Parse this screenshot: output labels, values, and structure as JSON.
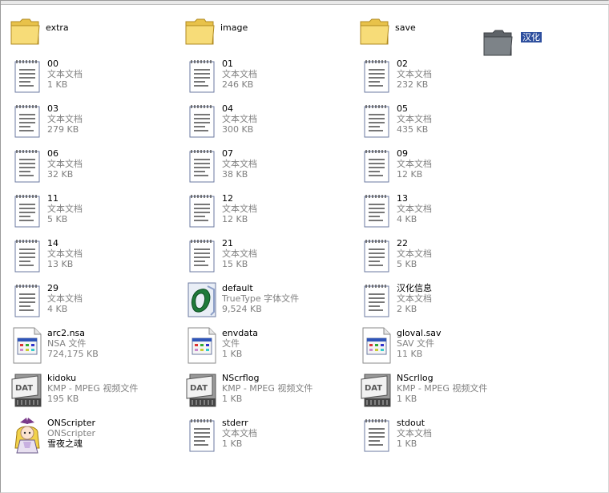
{
  "folders": [
    {
      "name": "extra",
      "icon": "folder-icon"
    },
    {
      "name": "image",
      "icon": "folder-icon"
    },
    {
      "name": "save",
      "icon": "folder-icon"
    }
  ],
  "selected_folder": {
    "name": "汉化",
    "icon": "folder-dark-icon"
  },
  "files": [
    {
      "name": "00",
      "type": "文本文档",
      "size": "1 KB",
      "icon": "text-document-icon"
    },
    {
      "name": "01",
      "type": "文本文档",
      "size": "246 KB",
      "icon": "text-document-icon"
    },
    {
      "name": "02",
      "type": "文本文档",
      "size": "232 KB",
      "icon": "text-document-icon"
    },
    {
      "name": "03",
      "type": "文本文档",
      "size": "279 KB",
      "icon": "text-document-icon"
    },
    {
      "name": "04",
      "type": "文本文档",
      "size": "300 KB",
      "icon": "text-document-icon"
    },
    {
      "name": "05",
      "type": "文本文档",
      "size": "435 KB",
      "icon": "text-document-icon"
    },
    {
      "name": "06",
      "type": "文本文档",
      "size": "32 KB",
      "icon": "text-document-icon"
    },
    {
      "name": "07",
      "type": "文本文档",
      "size": "38 KB",
      "icon": "text-document-icon"
    },
    {
      "name": "09",
      "type": "文本文档",
      "size": "12 KB",
      "icon": "text-document-icon"
    },
    {
      "name": "11",
      "type": "文本文档",
      "size": "5 KB",
      "icon": "text-document-icon"
    },
    {
      "name": "12",
      "type": "文本文档",
      "size": "12 KB",
      "icon": "text-document-icon"
    },
    {
      "name": "13",
      "type": "文本文档",
      "size": "4 KB",
      "icon": "text-document-icon"
    },
    {
      "name": "14",
      "type": "文本文档",
      "size": "13 KB",
      "icon": "text-document-icon"
    },
    {
      "name": "21",
      "type": "文本文档",
      "size": "15 KB",
      "icon": "text-document-icon"
    },
    {
      "name": "22",
      "type": "文本文档",
      "size": "5 KB",
      "icon": "text-document-icon"
    },
    {
      "name": "29",
      "type": "文本文档",
      "size": "4 KB",
      "icon": "text-document-icon"
    },
    {
      "name": "default",
      "type": "TrueType 字体文件",
      "size": "9,524 KB",
      "icon": "truetype-font-icon"
    },
    {
      "name": "汉化信息",
      "type": "文本文档",
      "size": "2 KB",
      "icon": "text-document-icon"
    },
    {
      "name": "arc2.nsa",
      "type": "NSA 文件",
      "size": "724,175 KB",
      "icon": "generic-file-icon"
    },
    {
      "name": "envdata",
      "type": "文件",
      "size": "1 KB",
      "icon": "generic-file-icon"
    },
    {
      "name": "gloval.sav",
      "type": "SAV 文件",
      "size": "11 KB",
      "icon": "generic-file-icon"
    },
    {
      "name": "kidoku",
      "type": "KMP - MPEG 视频文件",
      "size": "195 KB",
      "icon": "dat-video-icon"
    },
    {
      "name": "NScrflog",
      "type": "KMP - MPEG 视频文件",
      "size": "1 KB",
      "icon": "dat-video-icon"
    },
    {
      "name": "NScrllog",
      "type": "KMP - MPEG 视频文件",
      "size": "1 KB",
      "icon": "dat-video-icon"
    },
    {
      "name": "ONScripter",
      "type": "ONScripter",
      "size": "雪夜之魂",
      "icon": "onscripter-app-icon"
    },
    {
      "name": "stderr",
      "type": "文本文档",
      "size": "1 KB",
      "icon": "text-document-icon"
    },
    {
      "name": "stdout",
      "type": "文本文档",
      "size": "1 KB",
      "icon": "text-document-icon"
    }
  ]
}
